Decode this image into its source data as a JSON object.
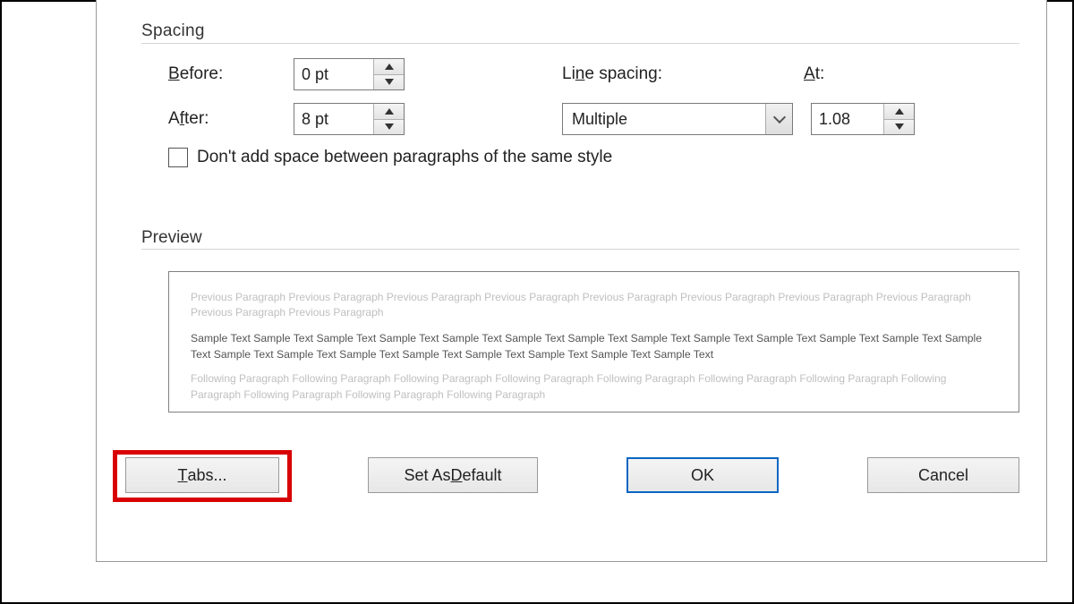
{
  "sections": {
    "spacing": "Spacing",
    "preview": "Preview"
  },
  "spacing": {
    "before_label": "Before:",
    "after_label": "After:",
    "before_value": "0 pt",
    "after_value": "8 pt",
    "line_spacing_label": "Line spacing:",
    "line_spacing_value": "Multiple",
    "at_label": "At:",
    "at_value": "1.08",
    "checkbox_label": "Don't add space between paragraphs of the same style",
    "checkbox_checked": false
  },
  "preview": {
    "prev_text": "Previous Paragraph Previous Paragraph Previous Paragraph Previous Paragraph Previous Paragraph Previous Paragraph Previous Paragraph Previous Paragraph Previous Paragraph Previous Paragraph",
    "sample_text": "Sample Text Sample Text Sample Text Sample Text Sample Text Sample Text Sample Text Sample Text Sample Text Sample Text Sample Text Sample Text Sample Text Sample Text Sample Text Sample Text Sample Text Sample Text Sample Text Sample Text Sample Text",
    "next_text": "Following Paragraph Following Paragraph Following Paragraph Following Paragraph Following Paragraph Following Paragraph Following Paragraph Following Paragraph Following Paragraph Following Paragraph Following Paragraph"
  },
  "buttons": {
    "tabs": "Tabs...",
    "set_default": "Set As Default",
    "ok": "OK",
    "cancel": "Cancel"
  }
}
